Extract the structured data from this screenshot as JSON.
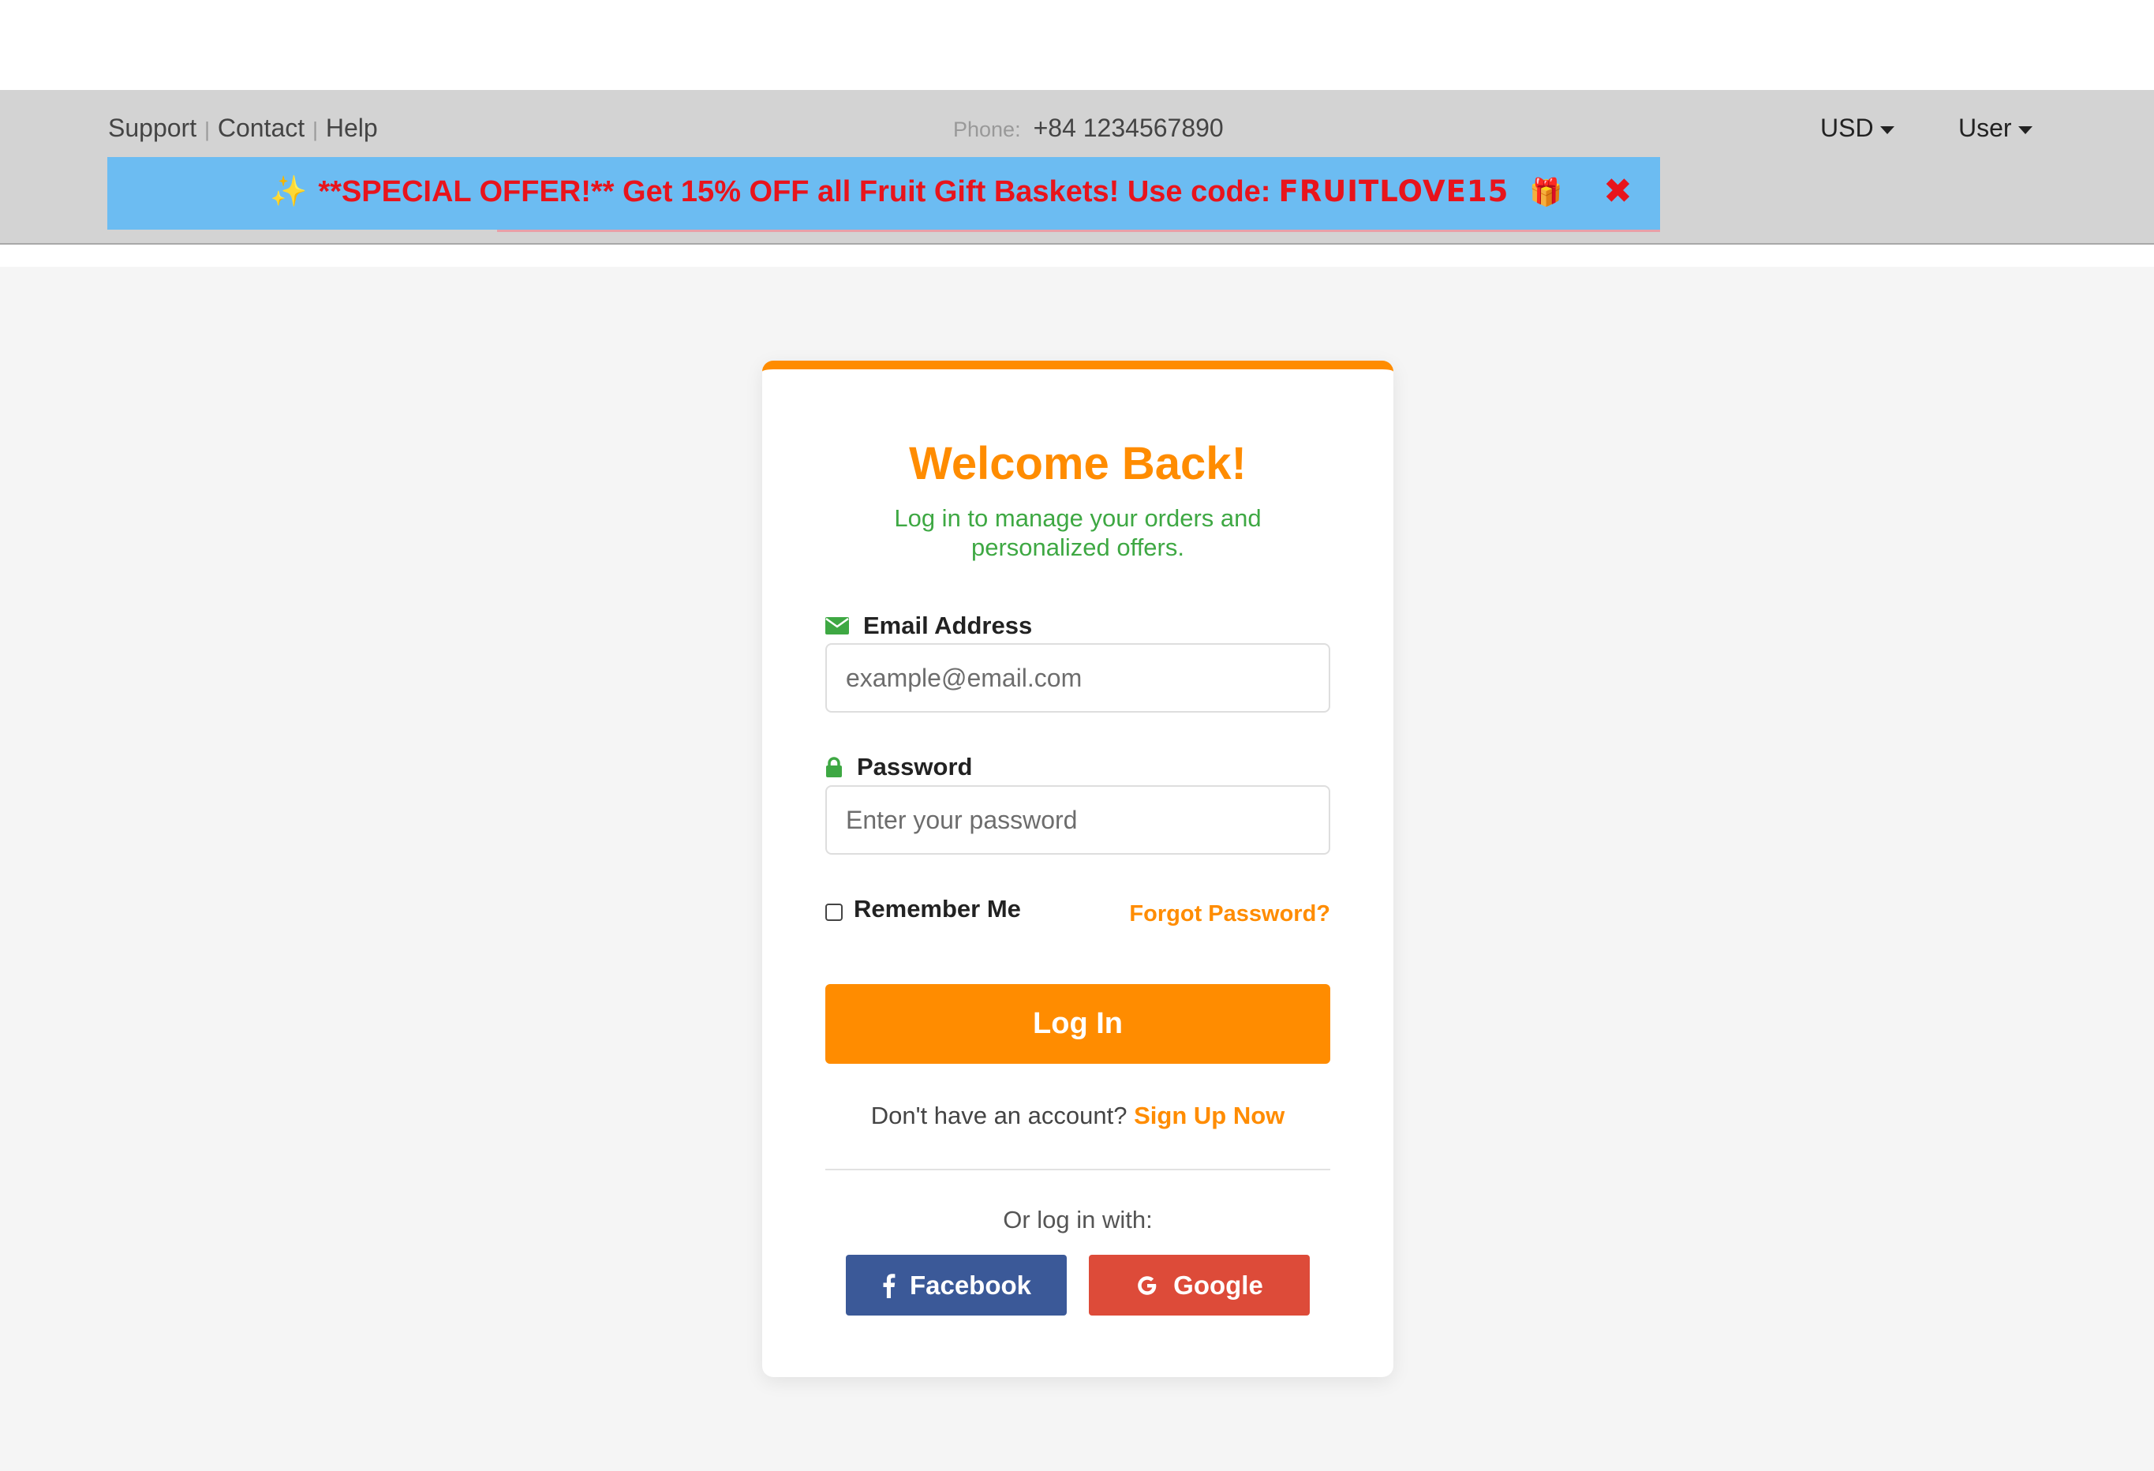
{
  "topbar": {
    "links": [
      "Support",
      "Contact",
      "Help"
    ],
    "phone_label": "Phone:",
    "phone_number": "+84 1234567890",
    "currency": "USD",
    "user": "User"
  },
  "promo": {
    "sparkle": "✨",
    "text": "**SPECIAL OFFER!** Get 15% OFF all Fruit Gift Baskets! Use code:",
    "code": "FRUITLOVE15",
    "gift": "🎁",
    "close": "✖"
  },
  "login": {
    "title": "Welcome Back!",
    "subtitle": "Log in to manage your orders and personalized offers.",
    "email_label": "Email Address",
    "email_placeholder": "example@email.com",
    "password_label": "Password",
    "password_placeholder": "Enter your password",
    "remember_label": "Remember Me",
    "forgot_label": "Forgot Password?",
    "submit_label": "Log In",
    "signup_prompt": "Don't have an account?",
    "signup_link": "Sign Up Now",
    "or_text": "Or log in with:",
    "facebook_label": "Facebook",
    "google_label": "Google"
  },
  "colors": {
    "accent": "#ff8c00",
    "green": "#3ea843",
    "promo_bg": "#6cbcf2",
    "promo_text": "#e8141c",
    "facebook": "#3b5998",
    "google": "#dd4b39"
  }
}
